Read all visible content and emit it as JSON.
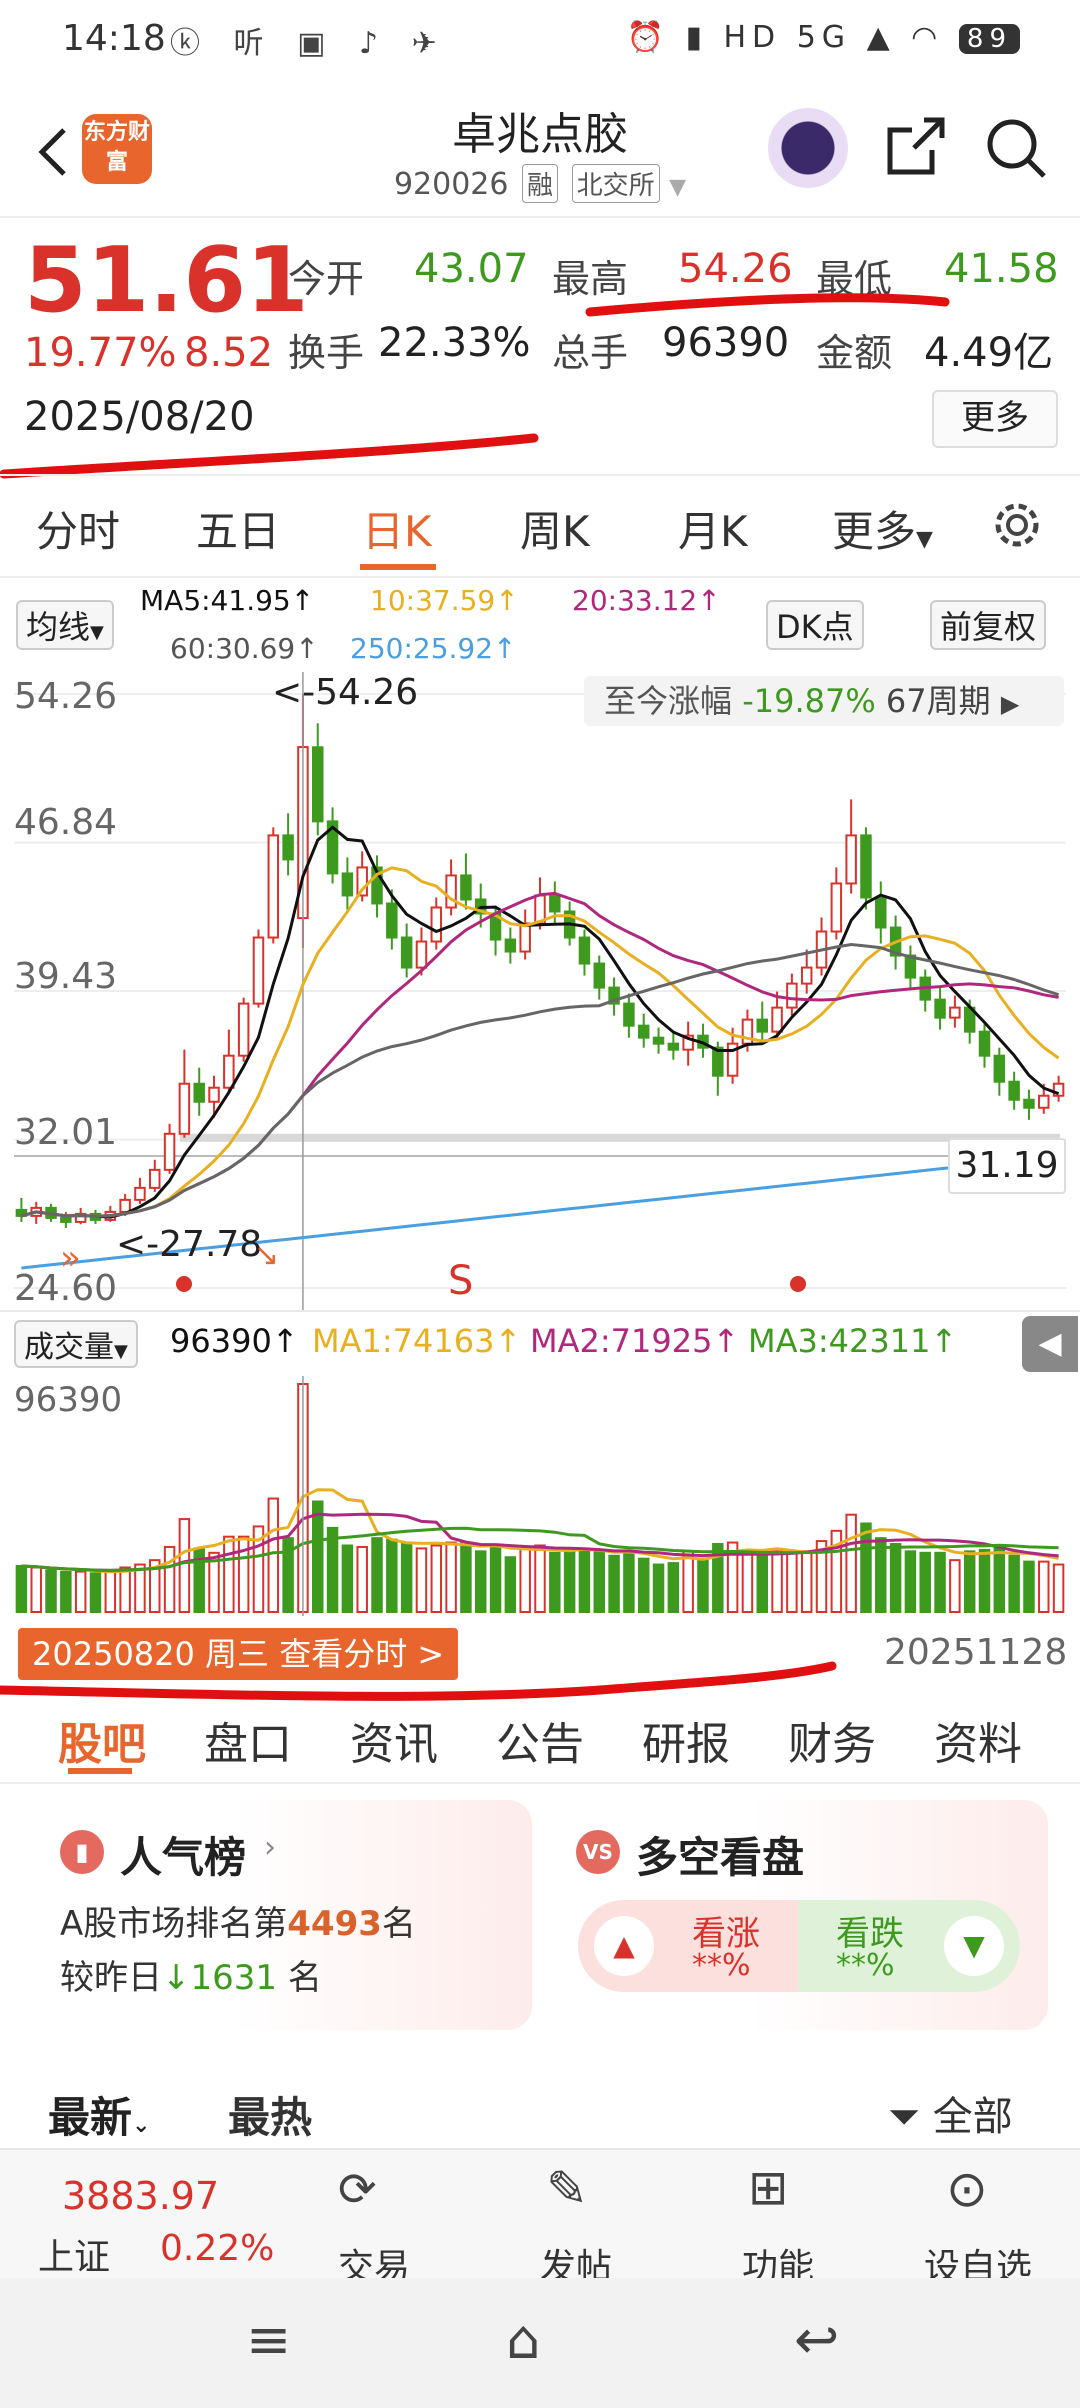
{
  "status_bar": {
    "time": "14:18",
    "left_icons": "ⓚ 听 ▣ ♪ ✈",
    "right_icons": "⏰ ▮ HD 5G ▲ ◠",
    "battery": "89"
  },
  "header": {
    "logo_text": "东方财富",
    "stock_name": "卓兆点胶",
    "stock_code": "920026",
    "tag_margin": "融",
    "tag_exchange": "北交所"
  },
  "quote": {
    "price": "51.61",
    "change_pct": "19.77%",
    "change": "8.52",
    "date": "2025/08/20",
    "open_label": "今开",
    "open": "43.07",
    "high_label": "最高",
    "high": "54.26",
    "low_label": "最低",
    "low": "41.58",
    "turnover_label": "换手",
    "turnover": "22.33%",
    "shares_label": "总手",
    "shares": "96390",
    "amount_label": "金额",
    "amount": "4.49亿",
    "more": "更多"
  },
  "period_tabs": [
    "分时",
    "五日",
    "日K",
    "周K",
    "月K",
    "更多"
  ],
  "active_tab": "日K",
  "ma_bar": {
    "selector": "均线",
    "ma5": "MA5:41.95↑",
    "ma10": "10:37.59↑",
    "ma20": "20:33.12↑",
    "ma60": "60:30.69↑",
    "ma250": "250:25.92↑",
    "dk": "DK点",
    "adjust": "前复权",
    "colors": {
      "ma5": "#111111",
      "ma10": "#e8b021",
      "ma20": "#b0287e",
      "ma60": "#666666",
      "ma250": "#4a9fe0"
    }
  },
  "kline": {
    "y_labels": [
      "54.26",
      "46.84",
      "39.43",
      "32.01",
      "24.60"
    ],
    "high_marker": "<-54.26",
    "low_marker": "<-27.78",
    "since_label": "至今涨幅",
    "since_value": "-19.87%",
    "since_periods": "67周期",
    "last_price_label": "31.19",
    "signal_s": "S"
  },
  "chart_data": {
    "type": "candlestick",
    "ylim": [
      24.6,
      54.26
    ],
    "candles": [
      [
        28.5,
        28.2,
        29.1,
        27.9
      ],
      [
        28.2,
        28.6,
        28.9,
        27.8
      ],
      [
        28.6,
        28.1,
        28.8,
        27.9
      ],
      [
        28.1,
        27.9,
        28.4,
        27.6
      ],
      [
        27.9,
        28.3,
        28.6,
        27.78
      ],
      [
        28.3,
        28.0,
        28.5,
        27.8
      ],
      [
        28.0,
        28.4,
        28.7,
        27.9
      ],
      [
        28.4,
        29.0,
        29.3,
        28.2
      ],
      [
        29.0,
        29.6,
        30.1,
        28.8
      ],
      [
        29.6,
        30.5,
        31.0,
        29.4
      ],
      [
        30.5,
        32.3,
        32.8,
        30.3
      ],
      [
        32.3,
        34.8,
        36.5,
        32.1
      ],
      [
        34.8,
        33.9,
        35.6,
        33.2
      ],
      [
        33.9,
        34.6,
        35.2,
        33.1
      ],
      [
        34.6,
        36.2,
        37.5,
        34.3
      ],
      [
        36.2,
        38.8,
        39.1,
        35.9
      ],
      [
        38.8,
        42.1,
        42.5,
        38.6
      ],
      [
        42.1,
        47.2,
        47.6,
        41.8
      ],
      [
        47.2,
        46.0,
        48.3,
        45.2
      ],
      [
        43.07,
        51.61,
        54.26,
        41.58
      ],
      [
        51.6,
        47.9,
        52.8,
        47.2
      ],
      [
        47.9,
        45.3,
        48.6,
        44.8
      ],
      [
        45.3,
        44.2,
        46.1,
        43.5
      ],
      [
        44.2,
        45.6,
        46.4,
        43.9
      ],
      [
        45.6,
        43.8,
        46.2,
        43.1
      ],
      [
        43.8,
        42.1,
        44.5,
        41.5
      ],
      [
        42.1,
        40.6,
        42.8,
        40.1
      ],
      [
        40.6,
        41.9,
        42.6,
        40.2
      ],
      [
        41.9,
        43.6,
        44.1,
        41.5
      ],
      [
        43.6,
        45.2,
        46.0,
        43.2
      ],
      [
        45.2,
        44.0,
        46.3,
        43.5
      ],
      [
        44.0,
        43.3,
        44.8,
        42.6
      ],
      [
        43.3,
        42.0,
        43.7,
        41.2
      ],
      [
        42.0,
        41.4,
        42.6,
        40.8
      ],
      [
        41.4,
        42.8,
        43.5,
        41.0
      ],
      [
        42.8,
        44.2,
        45.1,
        42.5
      ],
      [
        44.2,
        43.4,
        44.9,
        42.8
      ],
      [
        43.4,
        42.1,
        43.9,
        41.7
      ],
      [
        42.1,
        40.8,
        42.5,
        40.2
      ],
      [
        40.8,
        39.6,
        41.2,
        39.0
      ],
      [
        39.6,
        38.8,
        40.1,
        38.2
      ],
      [
        38.8,
        37.7,
        39.3,
        37.1
      ],
      [
        37.7,
        37.1,
        38.3,
        36.6
      ],
      [
        37.1,
        36.8,
        37.6,
        36.3
      ],
      [
        36.8,
        36.5,
        37.4,
        36.0
      ],
      [
        36.5,
        37.2,
        37.9,
        35.7
      ],
      [
        37.2,
        36.6,
        37.8,
        36.1
      ],
      [
        36.6,
        35.2,
        36.9,
        34.2
      ],
      [
        35.2,
        36.8,
        37.6,
        34.8
      ],
      [
        36.8,
        38.0,
        38.5,
        36.4
      ],
      [
        38.0,
        37.4,
        38.9,
        36.9
      ],
      [
        37.4,
        38.6,
        39.4,
        37.1
      ],
      [
        38.6,
        39.8,
        40.3,
        38.2
      ],
      [
        39.8,
        40.6,
        41.5,
        39.3
      ],
      [
        40.6,
        42.4,
        43.1,
        40.2
      ],
      [
        42.4,
        44.8,
        45.6,
        42.0
      ],
      [
        44.8,
        47.2,
        49.0,
        44.3
      ],
      [
        47.2,
        44.1,
        47.6,
        43.5
      ],
      [
        44.1,
        42.6,
        44.9,
        41.8
      ],
      [
        42.6,
        41.2,
        43.2,
        40.5
      ],
      [
        41.2,
        40.1,
        41.7,
        39.5
      ],
      [
        40.1,
        39.0,
        40.5,
        38.4
      ],
      [
        39.0,
        38.1,
        39.6,
        37.5
      ],
      [
        38.1,
        38.6,
        39.2,
        37.6
      ],
      [
        38.6,
        37.4,
        39.0,
        36.8
      ],
      [
        37.4,
        36.2,
        37.9,
        35.6
      ],
      [
        36.2,
        34.9,
        36.6,
        34.2
      ],
      [
        34.9,
        34.0,
        35.4,
        33.5
      ],
      [
        34.0,
        33.6,
        34.5,
        33.0
      ],
      [
        33.6,
        34.2,
        34.8,
        33.3
      ],
      [
        34.2,
        34.8,
        35.2,
        33.9
      ]
    ]
  },
  "volume": {
    "selector": "成交量",
    "current": "96390↑",
    "ma1": "MA1:74163↑",
    "ma2": "MA2:71925↑",
    "ma3": "MA3:42311↑",
    "y_label": "96390",
    "date_button": "20250820 周三 查看分时 >",
    "end_date": "20251128"
  },
  "section_tabs": [
    "股吧",
    "盘口",
    "资讯",
    "公告",
    "研报",
    "财务",
    "资料"
  ],
  "active_section": "股吧",
  "popularity": {
    "title": "人气榜",
    "rank_prefix": "A股市场排名第",
    "rank": "4493",
    "rank_suffix": "名",
    "change_prefix": "较昨日",
    "change": "1631",
    "change_suffix": "名"
  },
  "sentiment": {
    "title": "多空看盘",
    "up_label": "看涨",
    "up_value": "**%",
    "down_label": "看跌",
    "down_value": "**%"
  },
  "feed": {
    "latest": "最新",
    "hot": "最热",
    "filter": "全部"
  },
  "footer": {
    "index_value": "3883.97",
    "index_name": "上证",
    "index_change": "0.22%",
    "trade": "交易",
    "post": "发帖",
    "functions": "功能",
    "watchlist": "设自选"
  }
}
